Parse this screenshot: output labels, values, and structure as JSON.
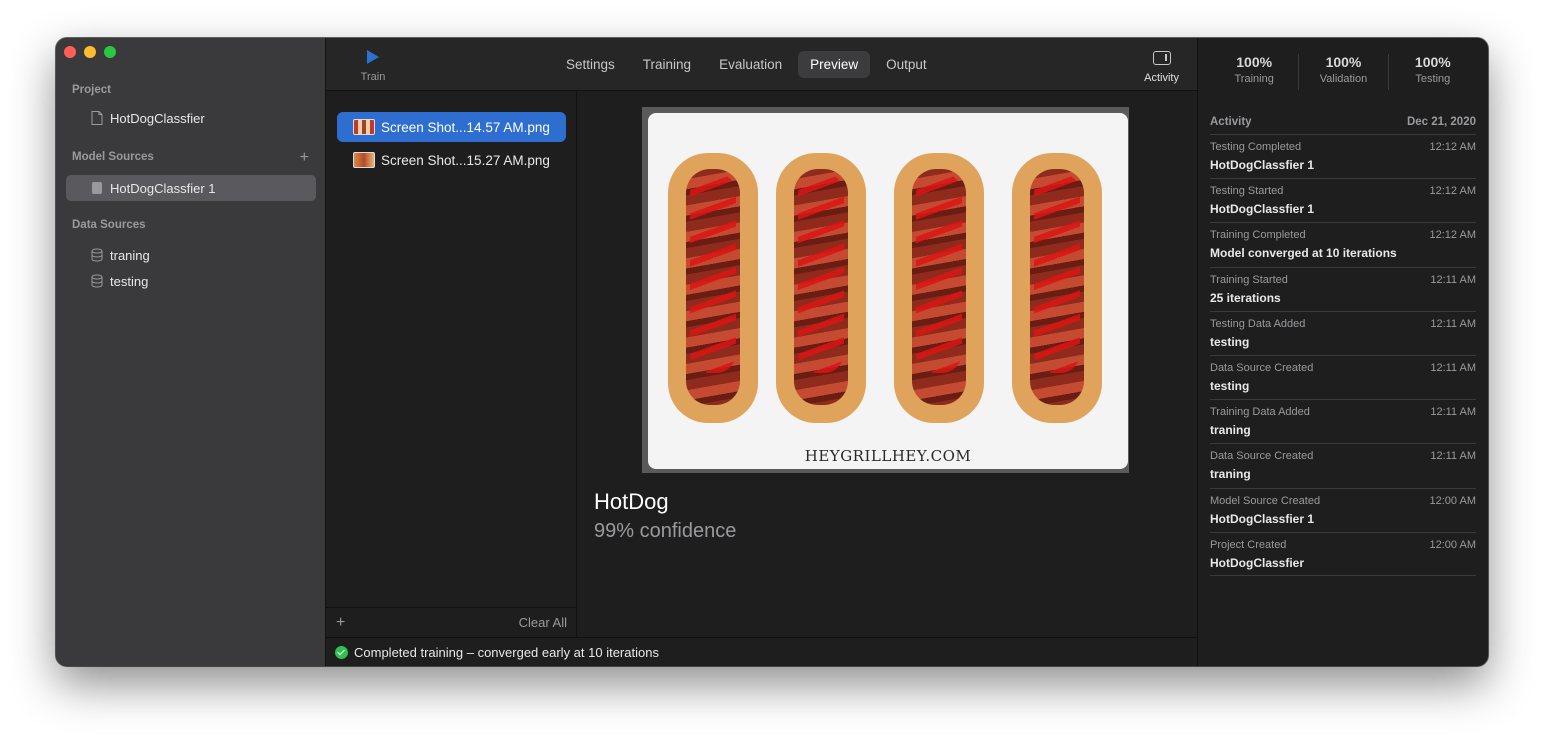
{
  "sidebar": {
    "project_section": "Project",
    "project_name": "HotDogClassfier",
    "model_sources_section": "Model Sources",
    "model_source": "HotDogClassfier 1",
    "data_sources_section": "Data Sources",
    "data_sources": [
      "traning",
      "testing"
    ]
  },
  "toolbar": {
    "train_label": "Train",
    "tabs": [
      "Settings",
      "Training",
      "Evaluation",
      "Preview",
      "Output"
    ],
    "active_tab": "Preview",
    "activity_label": "Activity"
  },
  "files": [
    {
      "name": "Screen Shot...14.57 AM.png",
      "selected": true
    },
    {
      "name": "Screen Shot...15.27 AM.png",
      "selected": false
    }
  ],
  "file_footer": {
    "clear_all": "Clear All"
  },
  "preview": {
    "watermark": "HEYGRILLHEY.COM",
    "label": "HotDog",
    "confidence": "99% confidence"
  },
  "status": {
    "text": "Completed training – converged early at 10 iterations"
  },
  "metrics": [
    {
      "value": "100%",
      "label": "Training"
    },
    {
      "value": "100%",
      "label": "Validation"
    },
    {
      "value": "100%",
      "label": "Testing"
    }
  ],
  "activity": {
    "title": "Activity",
    "date": "Dec 21, 2020",
    "items": [
      {
        "event": "Testing Completed",
        "time": "12:12 AM",
        "detail": "HotDogClassfier 1"
      },
      {
        "event": "Testing Started",
        "time": "12:12 AM",
        "detail": "HotDogClassfier 1"
      },
      {
        "event": "Training Completed",
        "time": "12:12 AM",
        "detail": "Model converged at 10 iterations"
      },
      {
        "event": "Training Started",
        "time": "12:11 AM",
        "detail": "25 iterations"
      },
      {
        "event": "Testing Data Added",
        "time": "12:11 AM",
        "detail": "testing"
      },
      {
        "event": "Data Source Created",
        "time": "12:11 AM",
        "detail": "testing"
      },
      {
        "event": "Training Data Added",
        "time": "12:11 AM",
        "detail": "traning"
      },
      {
        "event": "Data Source Created",
        "time": "12:11 AM",
        "detail": "traning"
      },
      {
        "event": "Model Source Created",
        "time": "12:00 AM",
        "detail": "HotDogClassfier 1"
      },
      {
        "event": "Project Created",
        "time": "12:00 AM",
        "detail": "HotDogClassfier"
      }
    ]
  },
  "colors": {
    "accent": "#2d6ed0",
    "success": "#30c04f",
    "sidebar_bg": "#3a3a3c",
    "content_bg": "#1e1e1e"
  }
}
